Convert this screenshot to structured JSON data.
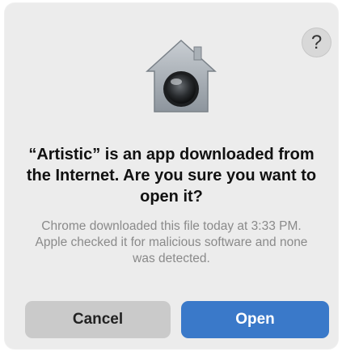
{
  "dialog": {
    "help_label": "?",
    "icon": "gatekeeper-lock-icon",
    "title": "“Artistic” is an app downloaded from the Internet. Are you sure you want to open it?",
    "message": "Chrome downloaded this file today at 3:33 PM. Apple checked it for malicious software and none was detected.",
    "cancel_label": "Cancel",
    "open_label": "Open"
  },
  "colors": {
    "dialog_background": "#ececec",
    "primary_button": "#3a79c9",
    "secondary_button": "#cacaca"
  }
}
